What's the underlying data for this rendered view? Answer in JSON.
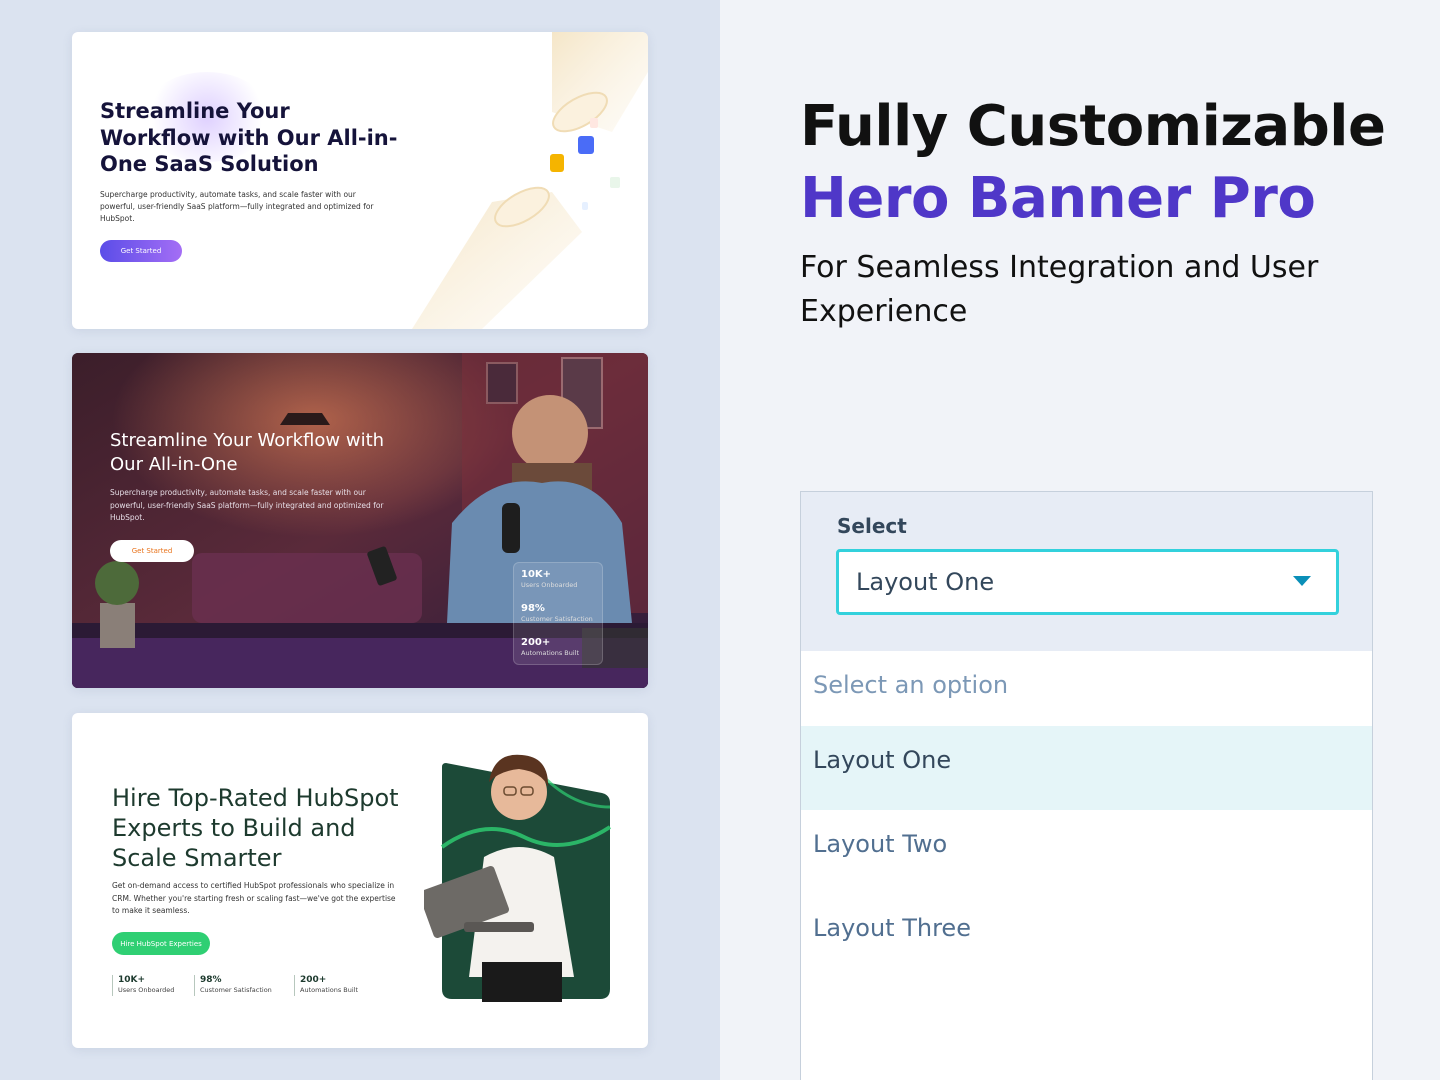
{
  "heading": {
    "line1": "Fully Customizable",
    "line2": "Hero Banner Pro",
    "subtitle": "For Seamless Integration and User Experience"
  },
  "colors": {
    "accent_purple": "#4f37c8",
    "select_focus": "#33d1dc",
    "option_highlight": "#e5f5f8",
    "green_button": "#2fcf73"
  },
  "previews": {
    "layout_one": {
      "title": "Streamline Your Workflow with Our All-in-One SaaS Solution",
      "description": "Supercharge productivity, automate tasks, and scale faster with our powerful, user-friendly SaaS platform—fully integrated and optimized for HubSpot.",
      "button": "Get Started"
    },
    "layout_two": {
      "title": "Streamline Your Workflow with Our All-in-One",
      "description": "Supercharge productivity, automate tasks, and scale faster with our powerful, user-friendly SaaS platform—fully integrated and optimized for HubSpot.",
      "button": "Get Started",
      "stats": [
        {
          "value": "10K+",
          "label": "Users Onboarded"
        },
        {
          "value": "98%",
          "label": "Customer Satisfaction"
        },
        {
          "value": "200+",
          "label": "Automations Built"
        }
      ]
    },
    "layout_three": {
      "title": "Hire Top-Rated HubSpot Experts to Build and Scale Smarter",
      "description": "Get on-demand access to certified HubSpot professionals who specialize in CRM. Whether you're starting fresh or scaling fast—we've got the expertise to make it seamless.",
      "button": "Hire HubSpot Experties",
      "stats": [
        {
          "value": "10K+",
          "label": "Users Onboarded"
        },
        {
          "value": "98%",
          "label": "Customer Satisfaction"
        },
        {
          "value": "200+",
          "label": "Automations Built"
        }
      ]
    }
  },
  "select": {
    "label": "Select",
    "value": "Layout One",
    "options": [
      {
        "label": "Select an option",
        "placeholder": true
      },
      {
        "label": "Layout One",
        "selected": true
      },
      {
        "label": "Layout Two"
      },
      {
        "label": "Layout Three"
      }
    ]
  }
}
